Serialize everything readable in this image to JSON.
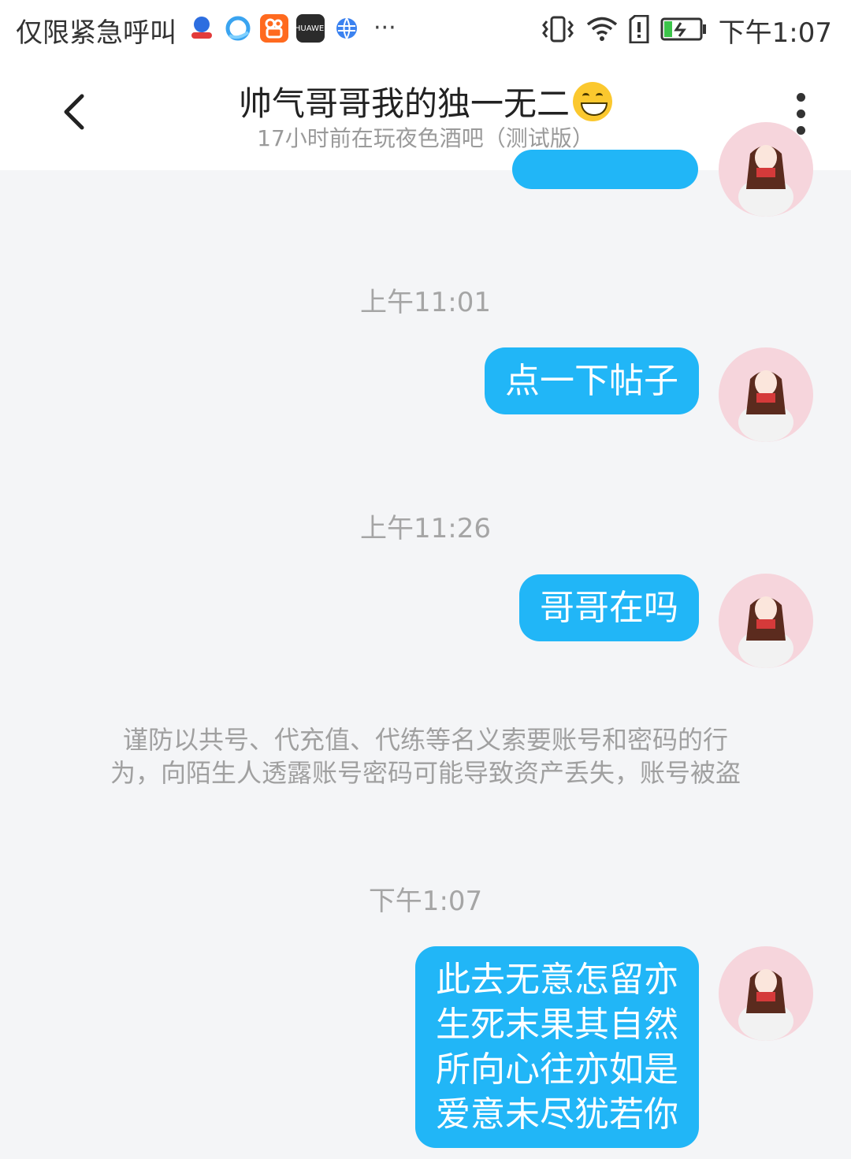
{
  "status_bar": {
    "carrier": "仅限紧急呼叫",
    "time": "下午1:07",
    "app_icons": [
      "baidu-icon",
      "browser-icon",
      "kuaishou-icon",
      "huawei-icon",
      "globe-icon"
    ],
    "more": "···"
  },
  "header": {
    "title": "帅气哥哥我的独一无二",
    "subtitle": "17小时前在玩夜色酒吧（测试版）"
  },
  "messages": [
    {
      "time": "上午11:01",
      "text": "点一下帖子"
    },
    {
      "time": "上午11:26",
      "text": "哥哥在吗"
    },
    {
      "time": "下午1:07",
      "lines": [
        "此去无意怎留亦",
        "生死末果其自然",
        "所向心往亦如是",
        "爱意未尽犹若你"
      ]
    }
  ],
  "warning": {
    "line1": "谨防以共号、代充值、代练等名义索要账号和密码的行",
    "line2": "为，向陌生人透露账号密码可能导致资产丢失，账号被盗"
  },
  "colors": {
    "bubble": "#21b6f7",
    "background": "#f4f5f7",
    "header": "#ffffff"
  }
}
